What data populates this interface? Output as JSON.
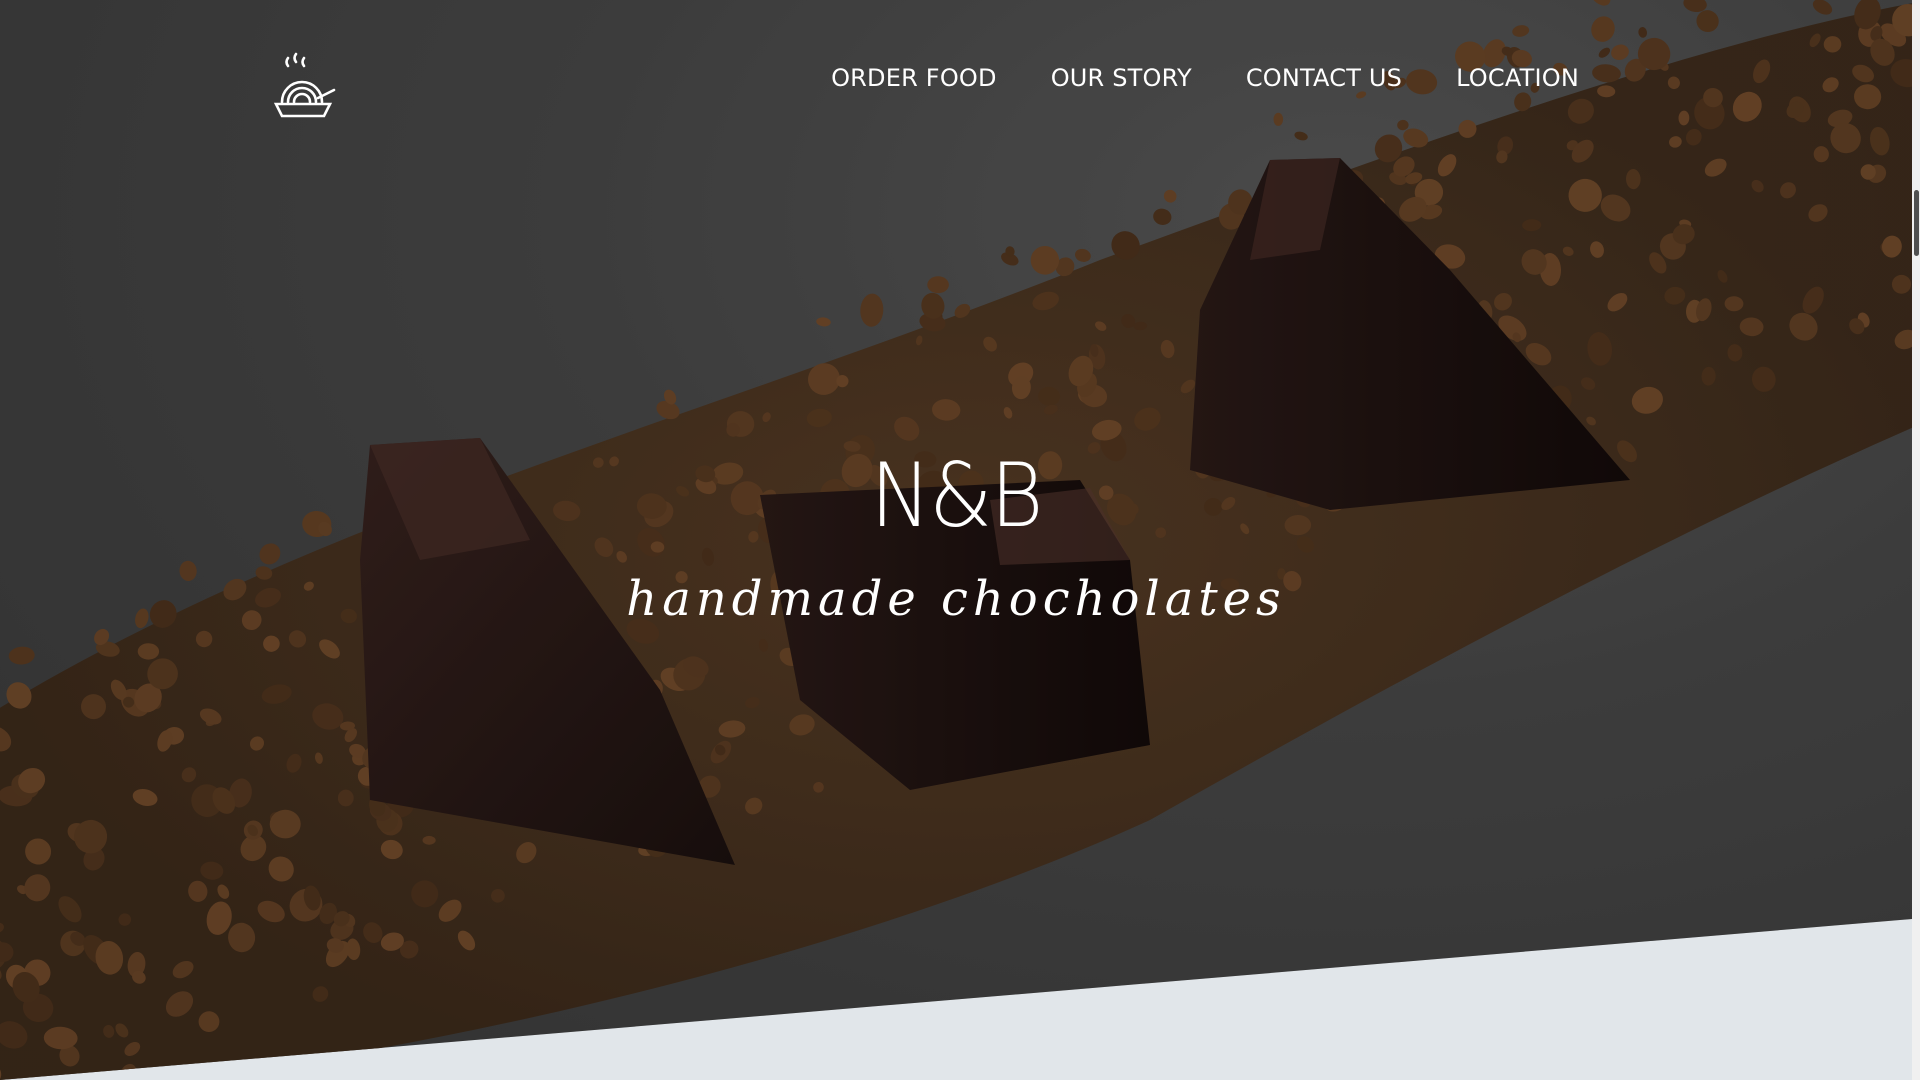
{
  "header": {
    "logo_icon": "noodle-bowl-icon"
  },
  "nav": {
    "items": [
      {
        "label": "ORDER FOOD"
      },
      {
        "label": "OUR STORY"
      },
      {
        "label": "CONTACT US"
      },
      {
        "label": "LOCATION"
      }
    ]
  },
  "hero": {
    "title": "N&B",
    "tagline": "handmade chocholates"
  },
  "colors": {
    "hero_overlay": "#4a4a4a",
    "section_bg": "#e1e6ea",
    "nav_text": "#ffffff",
    "chocolate": "#2a1a16",
    "cocoa_crumbs": "#6b4a2b"
  }
}
